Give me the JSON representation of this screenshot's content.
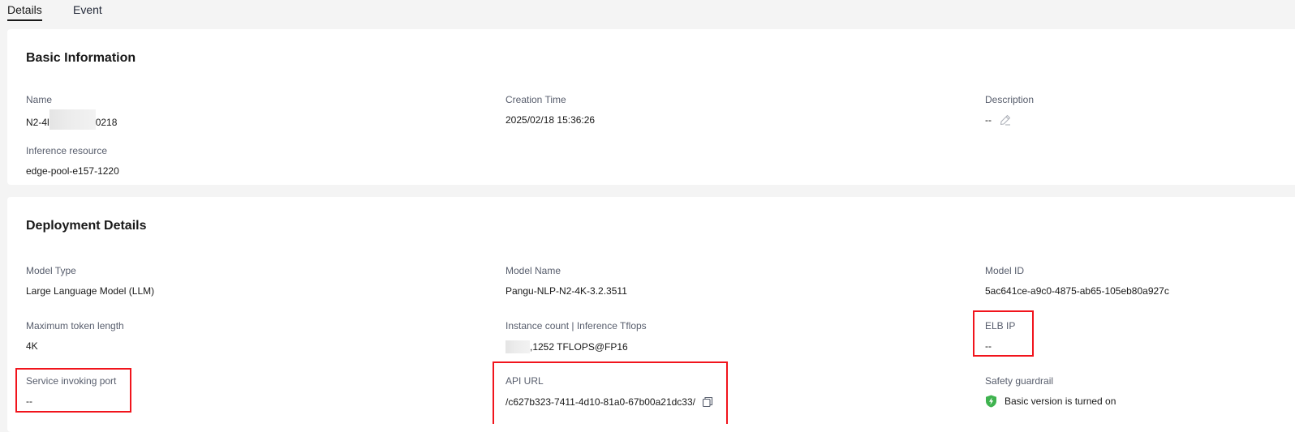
{
  "tabs": [
    {
      "label": "Details",
      "active": true
    },
    {
      "label": "Event",
      "active": false
    }
  ],
  "basic": {
    "title": "Basic Information",
    "name": {
      "label": "Name",
      "value_start": "N2-4l",
      "value_end": "0218"
    },
    "creation_time": {
      "label": "Creation Time",
      "value": "2025/02/18 15:36:26"
    },
    "description": {
      "label": "Description",
      "value": "--"
    },
    "inference_resource": {
      "label": "Inference resource",
      "value": "edge-pool-e157-1220"
    }
  },
  "deployment": {
    "title": "Deployment Details",
    "model_type": {
      "label": "Model Type",
      "value": "Large Language Model (LLM)"
    },
    "model_name": {
      "label": "Model Name",
      "value": "Pangu-NLP-N2-4K-3.2.3511"
    },
    "model_id": {
      "label": "Model ID",
      "value": "5ac641ce-a9c0-4875-ab65-105eb80a927c"
    },
    "max_token": {
      "label": "Maximum token length",
      "value": "4K"
    },
    "instance_count": {
      "label": "Instance count | Inference Tflops",
      "value": ",1252 TFLOPS@FP16"
    },
    "elb_ip": {
      "label": "ELB IP",
      "value": "--"
    },
    "service_port": {
      "label": "Service invoking port",
      "value": "--"
    },
    "api_url": {
      "label": "API URL",
      "value": "/c627b323-7411-4d10-81a0-67b00a21dc33/"
    },
    "safety_guardrail": {
      "label": "Safety guardrail",
      "value": "Basic version is turned on"
    }
  },
  "colors": {
    "highlight": "#f1141c",
    "shield": "#3fb34f"
  }
}
